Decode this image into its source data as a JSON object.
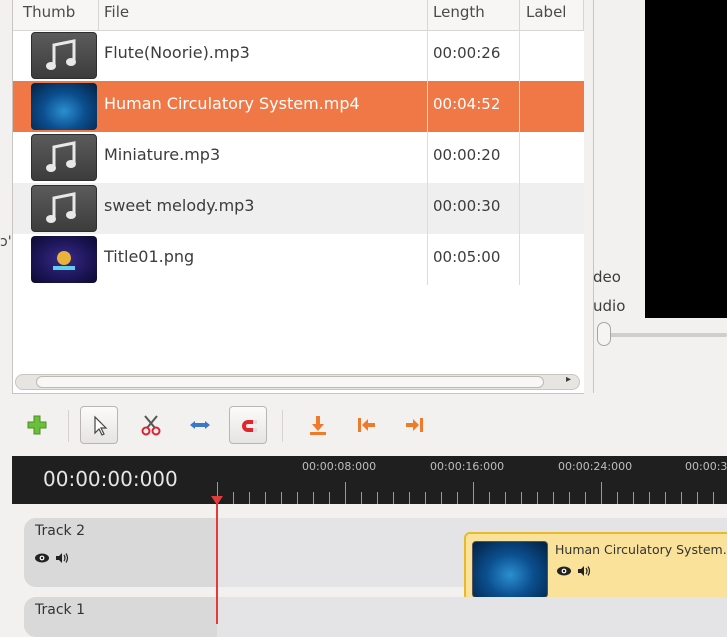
{
  "file_list": {
    "columns": {
      "thumb": "Thumb",
      "file": "File",
      "length": "Length",
      "label": "Label"
    },
    "rows": [
      {
        "name": "Flute(Noorie).mp3",
        "length": "00:00:26",
        "type": "audio"
      },
      {
        "name": "Human Circulatory System.mp4",
        "length": "00:04:52",
        "type": "video",
        "selected": true
      },
      {
        "name": "Miniature.mp3",
        "length": "00:00:20",
        "type": "audio"
      },
      {
        "name": "sweet melody.mp3",
        "length": "00:00:30",
        "type": "audio"
      },
      {
        "name": "Title01.png",
        "length": "00:05:00",
        "type": "image"
      }
    ]
  },
  "preview": {
    "video_label": "deo",
    "audio_label": "udio"
  },
  "toolbar": {
    "tools": [
      "add-icon",
      "pointer-icon",
      "razor-icon",
      "resize-icon",
      "snap-magnet-icon",
      "jump-playhead-icon",
      "jump-start-icon",
      "jump-end-icon"
    ]
  },
  "timeline": {
    "timecode": "00:00:00:000",
    "ruler_labels": [
      "00:00:08:000",
      "00:00:16:000",
      "00:00:24:000",
      "00:00:3"
    ]
  },
  "tracks": [
    {
      "name": "Track 2",
      "clip": {
        "title": "Human Circulatory System.m"
      }
    },
    {
      "name": "Track 1"
    }
  ],
  "stray_glyph": "ɔ'",
  "colors": {
    "selection": "#f07746",
    "clip": "#fbe29b",
    "playhead": "#e23b3b",
    "ruler": "#1f1f1f"
  }
}
